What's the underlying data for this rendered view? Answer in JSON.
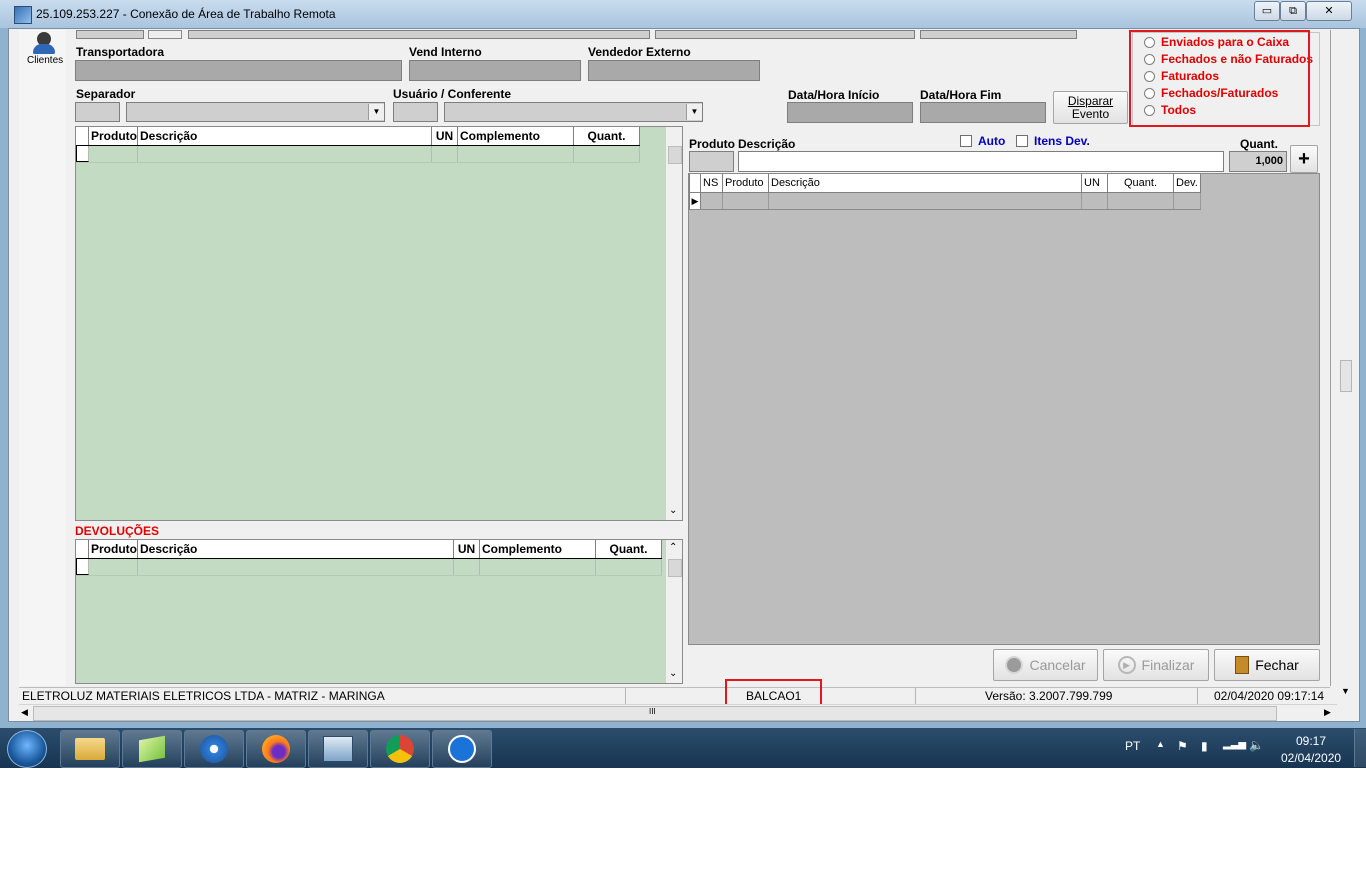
{
  "window": {
    "title": "25.109.253.227 - Conexão de Área de Trabalho Remota",
    "minimize": "▭",
    "restore": "⧉",
    "close": "✕"
  },
  "sidebar": {
    "clients_label": "Clientes"
  },
  "form": {
    "transportadora_label": "Transportadora",
    "vend_interno_label": "Vend Interno",
    "vendedor_externo_label": "Vendedor Externo",
    "separador_label": "Separador",
    "usuario_conferente_label": "Usuário / Conferente",
    "data_hora_inicio_label": "Data/Hora Início",
    "data_hora_fim_label": "Data/Hora Fim",
    "disparar_evento_label": [
      "Disparar",
      "Evento"
    ]
  },
  "filters": {
    "options": [
      "Enviados para o Caixa",
      "Fechados e não Faturados",
      "Faturados",
      "Fechados/Faturados",
      "Todos"
    ]
  },
  "left_grid": {
    "columns": [
      "Produto",
      "Descrição",
      "UN",
      "Complemento",
      "Quant."
    ]
  },
  "devolucoes": {
    "title": "DEVOLUÇÕES",
    "columns": [
      "Produto",
      "Descrição",
      "UN",
      "Complemento",
      "Quant."
    ]
  },
  "entry": {
    "produto_label": "Produto",
    "descricao_label": "Descrição",
    "auto_label": "Auto",
    "itens_dev_label": "Itens Dev.",
    "quant_label": "Quant.",
    "quant_value": "1,000",
    "add_label": "+"
  },
  "right_grid": {
    "columns": [
      "NS",
      "Produto",
      "Descrição",
      "UN",
      "Quant.",
      "Dev."
    ]
  },
  "actions": {
    "cancelar_label": "Cancelar",
    "finalizar_label": "Finalizar",
    "fechar_label": "Fechar"
  },
  "status_bar": {
    "company": "ELETROLUZ MATERIAIS ELETRICOS LTDA  -  MATRIZ - MARINGA",
    "station": "BALCAO1",
    "version": "Versão: 3.2007.799.799",
    "datetime": "02/04/2020 09:17:14"
  },
  "scroll": {
    "hgrip": "III"
  },
  "taskbar": {
    "lang": "PT",
    "time": "09:17",
    "date": "02/04/2020"
  },
  "colors": {
    "accent_red": "#e00000",
    "grid_green": "#c3dbc3",
    "link_blue": "#0000c0"
  }
}
